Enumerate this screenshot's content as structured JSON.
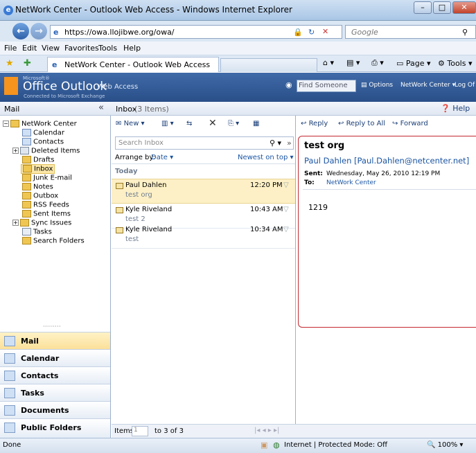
{
  "window": {
    "title": "NetWork Center - Outlook Web Access - Windows Internet Explorer"
  },
  "address_bar": {
    "url": "https://owa.llojibwe.org/owa/",
    "search_placeholder": "Google"
  },
  "menu": [
    "File",
    "Edit",
    "View",
    "Favorites",
    "Tools",
    "Help"
  ],
  "tabs": {
    "active": "NetWork Center - Outlook Web Access"
  },
  "ie_commands": {
    "page": "Page",
    "tools": "Tools"
  },
  "owa_header": {
    "microsoft": "Microsoft®",
    "product": "Office Outlook",
    "product_suffix": "Web Access",
    "connected": "Connected to Microsoft Exchange",
    "find_placeholder": "Find Someone",
    "options": "Options",
    "mailbox": "NetWork Center",
    "logoff": "Log Of"
  },
  "section_headers": {
    "left": "Mail",
    "middle_title": "Inbox",
    "middle_count": "(3 Items)",
    "help": "Help"
  },
  "folders": [
    {
      "label": "NetWork Center",
      "level": 0,
      "expand": "−"
    },
    {
      "label": "Calendar",
      "level": 1
    },
    {
      "label": "Contacts",
      "level": 1
    },
    {
      "label": "Deleted Items",
      "level": 1,
      "expand": "+"
    },
    {
      "label": "Drafts",
      "level": 1
    },
    {
      "label": "Inbox",
      "level": 1,
      "selected": true
    },
    {
      "label": "Junk E-mail",
      "level": 1
    },
    {
      "label": "Notes",
      "level": 1
    },
    {
      "label": "Outbox",
      "level": 1
    },
    {
      "label": "RSS Feeds",
      "level": 1
    },
    {
      "label": "Sent Items",
      "level": 1
    },
    {
      "label": "Sync Issues",
      "level": 1,
      "expand": "+"
    },
    {
      "label": "Tasks",
      "level": 1
    },
    {
      "label": "Search Folders",
      "level": 1
    }
  ],
  "nav_sections": [
    "Mail",
    "Calendar",
    "Contacts",
    "Tasks",
    "Documents",
    "Public Folders"
  ],
  "toolbar": {
    "new": "New",
    "search_placeholder": "Search Inbox"
  },
  "list": {
    "arrange_label": "Arrange by:",
    "arrange_value": "Date",
    "sort": "Newest on top",
    "group": "Today",
    "messages": [
      {
        "from": "Paul Dahlen",
        "time": "12:20 PM",
        "subject": "test org",
        "selected": true
      },
      {
        "from": "Kyle Riveland",
        "time": "10:43 AM",
        "subject": "test 2"
      },
      {
        "from": "Kyle Riveland",
        "time": "10:34 AM",
        "subject": "test"
      }
    ]
  },
  "footer": {
    "items_label": "Items",
    "page_value": "1",
    "range": "to 3 of 3"
  },
  "reading": {
    "reply": "Reply",
    "reply_all": "Reply to All",
    "forward": "Forward",
    "subject": "test org",
    "from": "Paul Dahlen [Paul.Dahlen@netcenter.net]",
    "sent_label": "Sent:",
    "sent_value": "Wednesday, May 26, 2010 12:19 PM",
    "to_label": "To:",
    "to_value": "NetWork Center",
    "body": "1219"
  },
  "statusbar": {
    "left": "Done",
    "zone": "Internet | Protected Mode: Off",
    "zoom": "100%"
  }
}
